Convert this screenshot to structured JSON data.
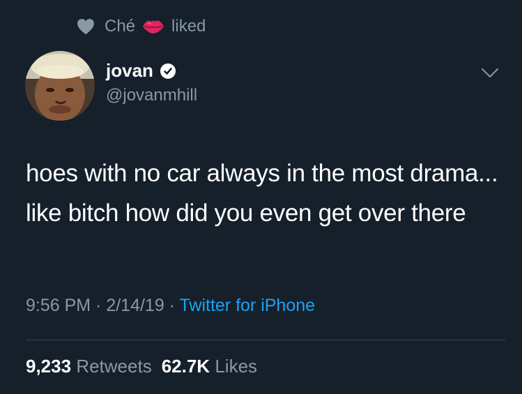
{
  "social_context": {
    "user": "Ché",
    "action": "liked",
    "icon": "heart-icon",
    "emoji": "kiss-lips-icon"
  },
  "author": {
    "name": "jovan",
    "handle": "@jovanmhill",
    "verified_icon": "verified-badge-icon",
    "avatar": "profile-photo"
  },
  "tweet": {
    "text": "hoes with no car always in the most drama... like bitch how did you even get over there"
  },
  "meta": {
    "time": "9:56 PM",
    "sep1": " · ",
    "date": "2/14/19",
    "sep2": " · ",
    "source": "Twitter for iPhone"
  },
  "stats": {
    "retweets_count": "9,233",
    "retweets_label": "Retweets",
    "likes_count": "62.7K",
    "likes_label": "Likes"
  },
  "colors": {
    "background": "#15202b",
    "secondary_text": "#8899a6",
    "link": "#1da1f2",
    "primary_text": "#ffffff"
  }
}
